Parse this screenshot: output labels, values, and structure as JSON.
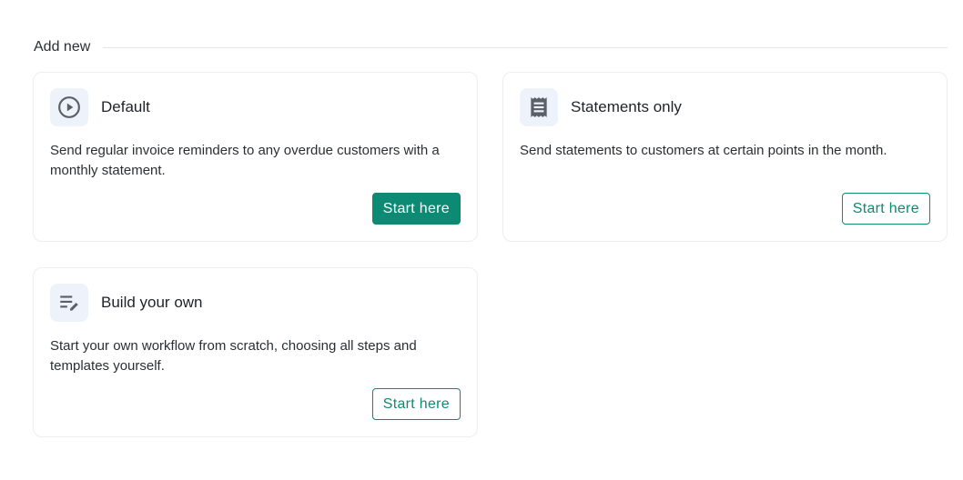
{
  "section": {
    "title": "Add new"
  },
  "cards": [
    {
      "icon": "play-circle-icon",
      "title": "Default",
      "description": "Send regular invoice reminders to any overdue customers with a monthly statement.",
      "button": "Start here",
      "button_style": "primary"
    },
    {
      "icon": "receipt-icon",
      "title": "Statements only",
      "description": "Send statements to customers at certain points in the month.",
      "button": "Start here",
      "button_style": "outline"
    },
    {
      "icon": "edit-list-icon",
      "title": "Build your own",
      "description": "Start your own workflow from scratch, choosing all steps and templates yourself.",
      "button": "Start here",
      "button_style": "outline"
    }
  ],
  "colors": {
    "accent": "#0c8a74",
    "icon_bg": "#eef3fb",
    "icon_fg": "#5b5f66",
    "border": "#eceef1"
  }
}
